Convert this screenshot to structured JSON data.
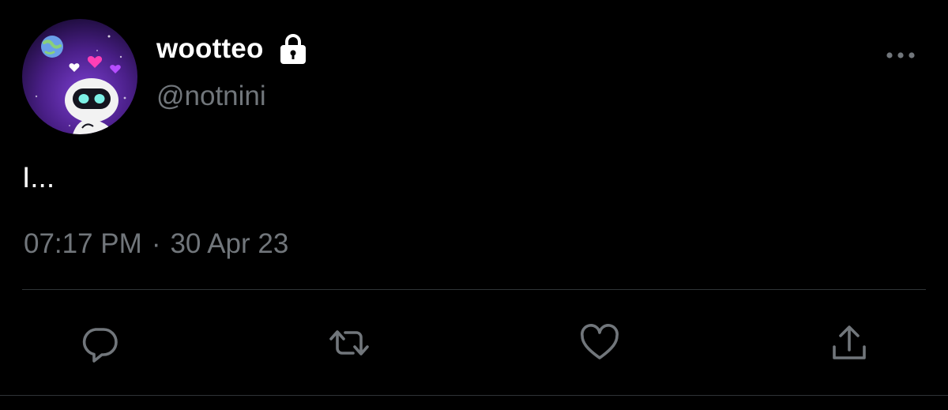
{
  "author": {
    "display_name": "wootteo",
    "handle": "@notnini",
    "protected": true,
    "avatar_icon": "robot-avatar-icon"
  },
  "tweet": {
    "text": "I...",
    "time": "07:17 PM",
    "separator": "·",
    "date": "30 Apr 23"
  },
  "actions": {
    "reply": "reply-icon",
    "retweet": "retweet-icon",
    "like": "heart-icon",
    "share": "share-icon",
    "more": "more-options-icon"
  },
  "colors": {
    "background": "#000000",
    "primary_text": "#ffffff",
    "secondary_text": "#71767b",
    "divider": "#2f3336",
    "avatar_bg": "#5b2a9e"
  }
}
